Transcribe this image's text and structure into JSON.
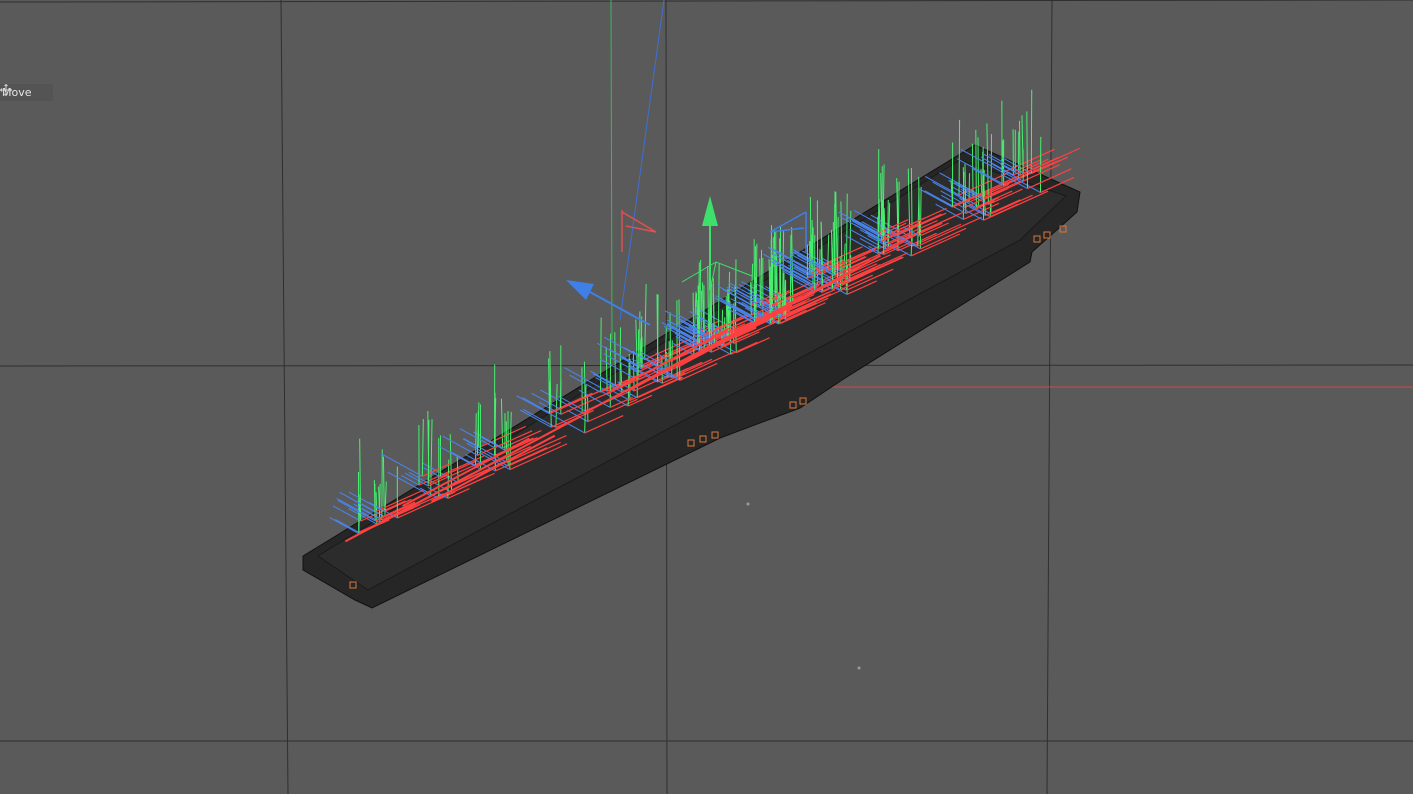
{
  "viewport": {
    "background": "#5a5a5b",
    "grid_color": "#2f2f30",
    "world_x_axis_color": "#c94a4a",
    "world_y_axis_color": "#3bb85a",
    "world_z_axis_color": "#3f6fd6"
  },
  "hud": {
    "active_tool_label": "Move",
    "active_tool_icon": "move-icon"
  },
  "gizmo": {
    "x_color": "#e05050",
    "y_color": "#3de06a",
    "z_color": "#3f7fe8"
  },
  "object": {
    "body_color": "#262626",
    "outline_color": "#111111",
    "pin_color": "#d9773a",
    "x_handle_color": "#ff4040",
    "y_handle_color": "#46f06e",
    "z_handle_color": "#4a86f0"
  }
}
